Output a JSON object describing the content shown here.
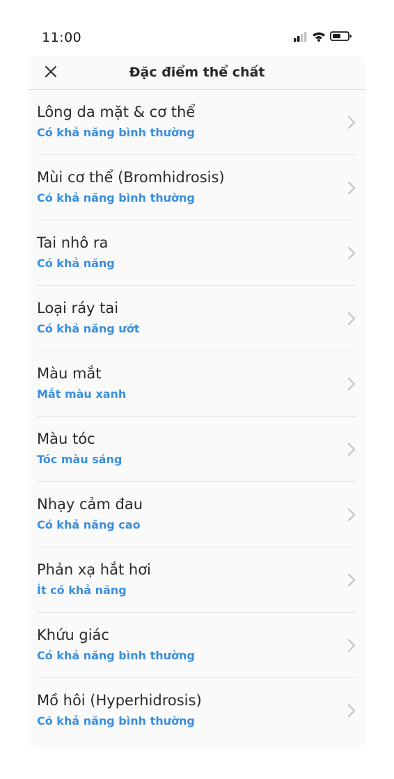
{
  "status_bar": {
    "time": "11:00",
    "icons": [
      "signal-icon",
      "wifi-icon",
      "battery-icon"
    ]
  },
  "header": {
    "title": "Đặc điểm thể chất",
    "close_icon": "close-icon"
  },
  "colors": {
    "accent": "#3a8fde",
    "card_background": "#fafafa",
    "divider": "#e2e2e2",
    "chevron": "#c8c8c8"
  },
  "items": [
    {
      "title": "Lông da mặt & cơ thể",
      "value": "Có khả năng bình thường"
    },
    {
      "title": "Mùi cơ thể (Bromhidrosis)",
      "value": "Có khả năng bình thường"
    },
    {
      "title": "Tai nhô ra",
      "value": "Có khả năng"
    },
    {
      "title": "Loại ráy tai",
      "value": "Có khả năng ướt"
    },
    {
      "title": "Màu mắt",
      "value": "Mắt màu xanh"
    },
    {
      "title": "Màu tóc",
      "value": "Tóc màu sáng"
    },
    {
      "title": "Nhạy cảm đau",
      "value": "Có khả năng cao"
    },
    {
      "title": "Phản xạ hắt hơi",
      "value": "Ít có khả năng"
    },
    {
      "title": "Khứu giác",
      "value": "Có khả năng bình thường"
    },
    {
      "title": "Mồ hôi (Hyperhidrosis)",
      "value": "Có khả năng bình thường"
    }
  ]
}
